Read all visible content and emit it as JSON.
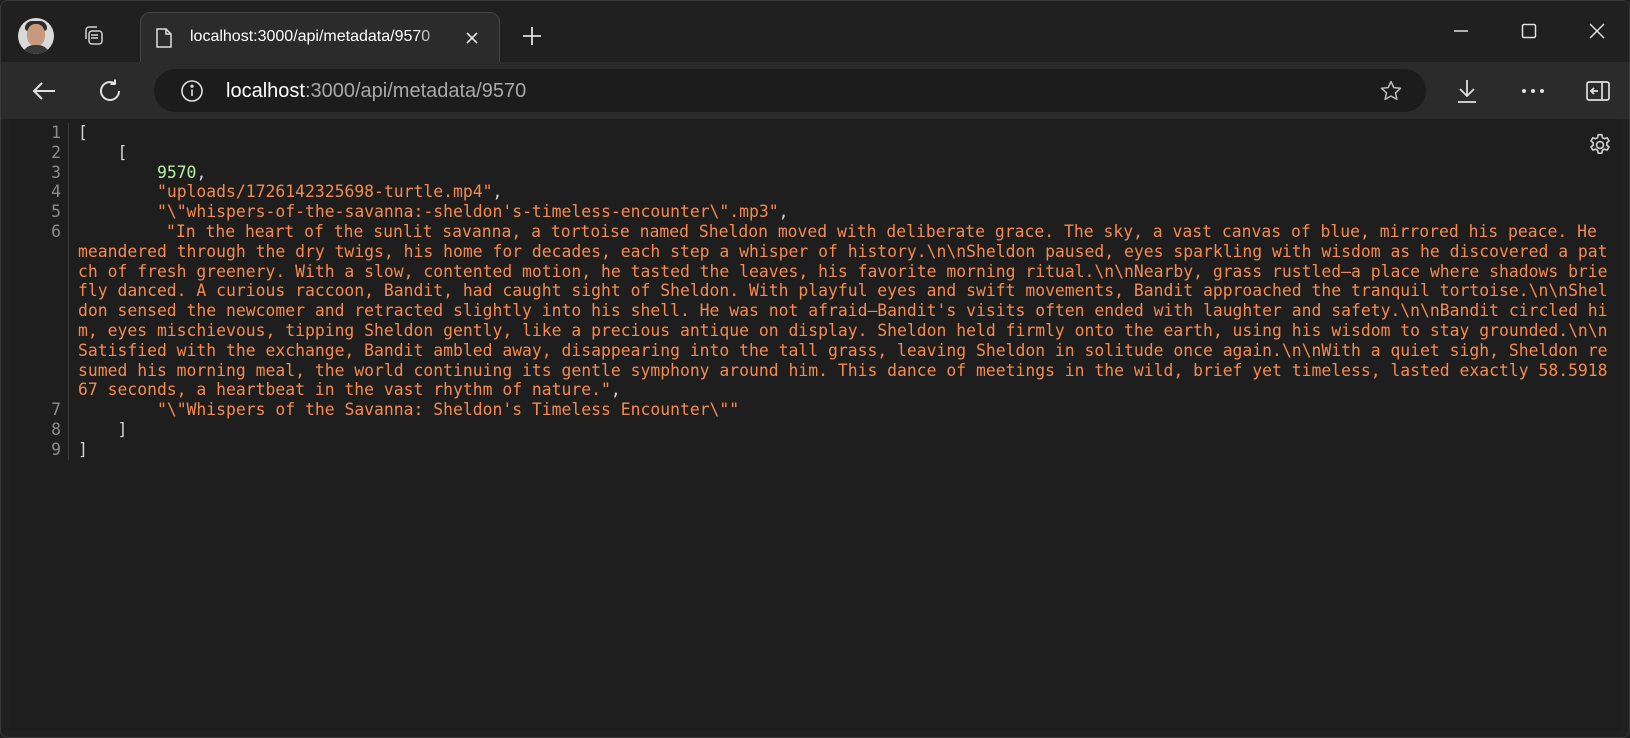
{
  "browser": {
    "tab": {
      "title": "localhost:3000/api/metadata/9570",
      "close_icon": "close-icon",
      "page_icon": "page-icon"
    },
    "address": {
      "host": "localhost",
      "rest": ":3000/api/metadata/9570"
    },
    "icons": {
      "profile": "avatar",
      "workspaces": "tab-actions-icon",
      "new_tab": "plus-icon",
      "back": "back-arrow-icon",
      "refresh": "refresh-icon",
      "info": "info-icon",
      "favorite": "star-icon",
      "downloads": "download-icon",
      "more": "more-icon",
      "sidebar": "sidebar-icon",
      "minimize": "minimize-icon",
      "maximize": "maximize-icon",
      "close": "close-icon",
      "settings": "gear-icon"
    }
  },
  "json_viewer": {
    "line_numbers": [
      "1",
      "2",
      "3",
      "4",
      "5",
      "6",
      "7",
      "8",
      "9"
    ],
    "open_outer": "[",
    "open_inner": "[",
    "id_value": "9570",
    "comma": ",",
    "video_path": "\"uploads/1726142325698-turtle.mp4\"",
    "audio_path": "\"\\\"whispers-of-the-savanna:-sheldon's-timeless-encounter\\\".mp3\"",
    "story_text": "\"In the heart of the sunlit savanna, a tortoise named Sheldon moved with deliberate grace. The sky, a vast canvas of blue, mirrored his peace. He meandered through the dry twigs, his home for decades, each step a whisper of history.\\n\\nSheldon paused, eyes sparkling with wisdom as he discovered a patch of fresh greenery. With a slow, contented motion, he tasted the leaves, his favorite morning ritual.\\n\\nNearby, grass rustled—a place where shadows briefly danced. A curious raccoon, Bandit, had caught sight of Sheldon. With playful eyes and swift movements, Bandit approached the tranquil tortoise.\\n\\nSheldon sensed the newcomer and retracted slightly into his shell. He was not afraid—Bandit's visits often ended with laughter and safety.\\n\\nBandit circled him, eyes mischievous, tipping Sheldon gently, like a precious antique on display. Sheldon held firmly onto the earth, using his wisdom to stay grounded.\\n\\nSatisfied with the exchange, Bandit ambled away, disappearing into the tall grass, leaving Sheldon in solitude once again.\\n\\nWith a quiet sigh, Sheldon resumed his morning meal, the world continuing its gentle symphony around him. This dance of meetings in the wild, brief yet timeless, lasted exactly 58.591867 seconds, a heartbeat in the vast rhythm of nature.\"",
    "title_text": "\"\\\"Whispers of the Savanna: Sheldon's Timeless Encounter\\\"\"",
    "close_inner": "]",
    "close_outer": "]"
  },
  "colors": {
    "background": "#1e1e1e",
    "number": "#b5f0a3",
    "string": "#f68a4c",
    "line_number": "#8c8c8c"
  }
}
